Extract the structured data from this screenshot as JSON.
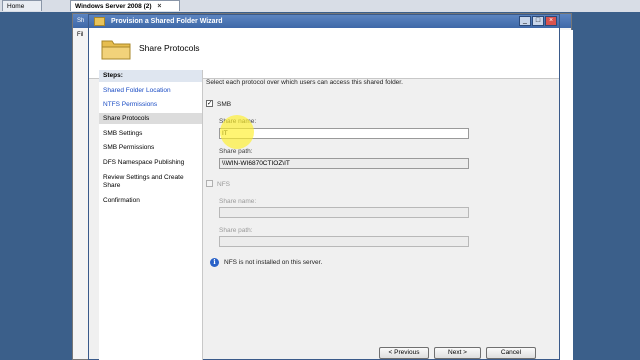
{
  "host_tabs": [
    {
      "label": "Home"
    },
    {
      "label": "Windows Server 2008 (2)"
    }
  ],
  "wizard": {
    "title": "Provision a Shared Folder Wizard",
    "header_title": "Share Protocols",
    "steps_header": "Steps:",
    "steps": [
      {
        "label": "Shared Folder Location"
      },
      {
        "label": "NTFS Permissions"
      },
      {
        "label": "Share Protocols"
      },
      {
        "label": "SMB Settings"
      },
      {
        "label": "SMB Permissions"
      },
      {
        "label": "DFS Namespace Publishing"
      },
      {
        "label": "Review Settings and Create Share"
      },
      {
        "label": "Confirmation"
      }
    ],
    "instruction": "Select each protocol over which users can access this shared folder.",
    "smb": {
      "label": "SMB",
      "checked": true,
      "share_name_label": "Share name:",
      "share_name_value": "IT",
      "share_path_label": "Share path:",
      "share_path_value": "\\\\WIN-WI6870CTIOZ\\IT"
    },
    "nfs": {
      "label": "NFS",
      "checked": false,
      "share_name_label": "Share name:",
      "share_path_label": "Share path:"
    },
    "nfs_note": "NFS is not installed on this server.",
    "buttons": {
      "previous": "< Previous",
      "next": "Next >",
      "cancel": "Cancel"
    }
  },
  "background": {
    "title_fragment": "Sh",
    "menu_fragment": "Fil"
  },
  "colors": {
    "titlebar": "#3e68a8",
    "link": "#1a4cc4",
    "info": "#2a62c8",
    "guest_desktop": "#3b5f8a"
  }
}
